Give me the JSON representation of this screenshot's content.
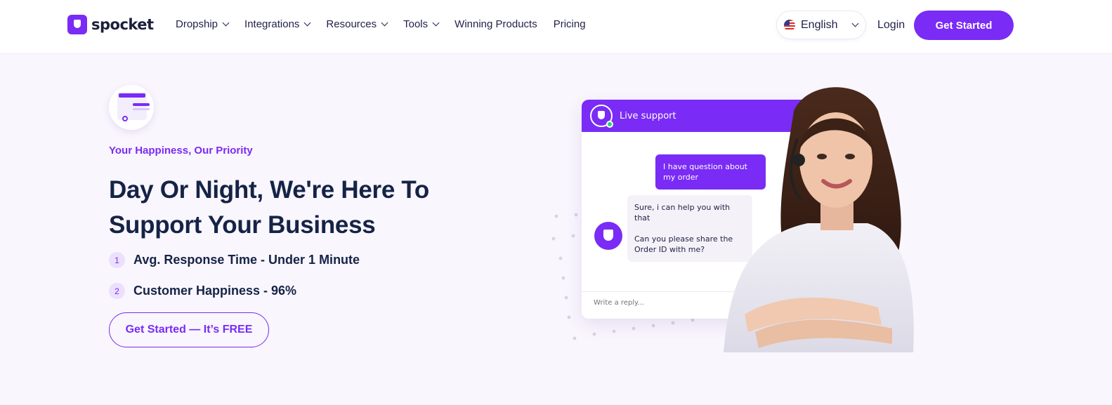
{
  "nav": {
    "logo_text": "spocket",
    "menu": [
      {
        "label": "Dropship",
        "dropdown": true
      },
      {
        "label": "Integrations",
        "dropdown": true
      },
      {
        "label": "Resources",
        "dropdown": true
      },
      {
        "label": "Tools",
        "dropdown": true
      },
      {
        "label": "Winning Products",
        "dropdown": false
      },
      {
        "label": "Pricing",
        "dropdown": false
      }
    ],
    "language": "English",
    "login": "Login",
    "cta": "Get Started"
  },
  "hero": {
    "eyebrow": "Your Happiness, Our Priority",
    "headline": "Day Or Night, We're Here To Support Your Business",
    "stats": [
      {
        "num": "1",
        "text": "Avg. Response Time - Under 1 Minute"
      },
      {
        "num": "2",
        "text": "Customer Happiness - 96%"
      }
    ],
    "cta": "Get Started — It’s FREE"
  },
  "chat": {
    "title": "Live support",
    "outgoing": "I have question about my order",
    "incoming": [
      "Sure, i can help you with that",
      "Can you please share the Order ID with me?"
    ],
    "reply_placeholder": "Write a reply..."
  },
  "colors": {
    "brand": "#7a2bf5",
    "heading": "#152346",
    "background": "#f9f6fd"
  }
}
